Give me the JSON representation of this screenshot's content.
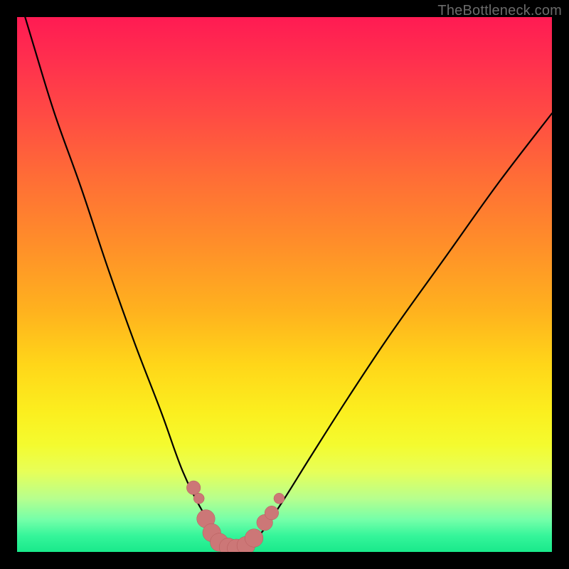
{
  "watermark": "TheBottleneck.com",
  "colors": {
    "frame_border": "#000000",
    "curve_stroke": "#000000",
    "dot_fill": "#cc7777",
    "dot_stroke": "#b55a5a",
    "gradient_stops": [
      "#ff1b53",
      "#ff2f4e",
      "#ff4a44",
      "#ff6d36",
      "#ff8d2a",
      "#ffb21e",
      "#ffd619",
      "#fbef1f",
      "#f4fb2f",
      "#e7ff58",
      "#b7ff8e",
      "#74ffa9",
      "#35f59a",
      "#19e98b"
    ]
  },
  "chart_data": {
    "type": "line",
    "title": "",
    "xlabel": "",
    "ylabel": "",
    "xlim": [
      0,
      100
    ],
    "ylim": [
      0,
      100
    ],
    "grid": false,
    "legend": false,
    "series": [
      {
        "name": "bottleneck-curve",
        "x": [
          0,
          3,
          7,
          12,
          17,
          22,
          27,
          31,
          35,
          38,
          40,
          42,
          44,
          46,
          50,
          55,
          62,
          70,
          80,
          90,
          100
        ],
        "y": [
          105,
          95,
          82,
          68,
          53,
          39,
          26,
          15,
          7,
          3,
          1,
          1,
          2,
          4,
          10,
          18,
          29,
          41,
          55,
          69,
          82
        ]
      }
    ],
    "annotations": {
      "dots": [
        {
          "x": 33.0,
          "y": 12.0,
          "r": 1.3
        },
        {
          "x": 34.0,
          "y": 10.0,
          "r": 1.0
        },
        {
          "x": 35.3,
          "y": 6.2,
          "r": 1.7
        },
        {
          "x": 36.4,
          "y": 3.6,
          "r": 1.7
        },
        {
          "x": 37.8,
          "y": 1.8,
          "r": 1.7
        },
        {
          "x": 39.5,
          "y": 0.9,
          "r": 1.7
        },
        {
          "x": 41.0,
          "y": 0.7,
          "r": 1.7
        },
        {
          "x": 42.8,
          "y": 1.2,
          "r": 1.7
        },
        {
          "x": 44.3,
          "y": 2.6,
          "r": 1.7
        },
        {
          "x": 46.3,
          "y": 5.5,
          "r": 1.5
        },
        {
          "x": 47.6,
          "y": 7.3,
          "r": 1.3
        },
        {
          "x": 49.0,
          "y": 10.0,
          "r": 1.0
        }
      ]
    }
  }
}
